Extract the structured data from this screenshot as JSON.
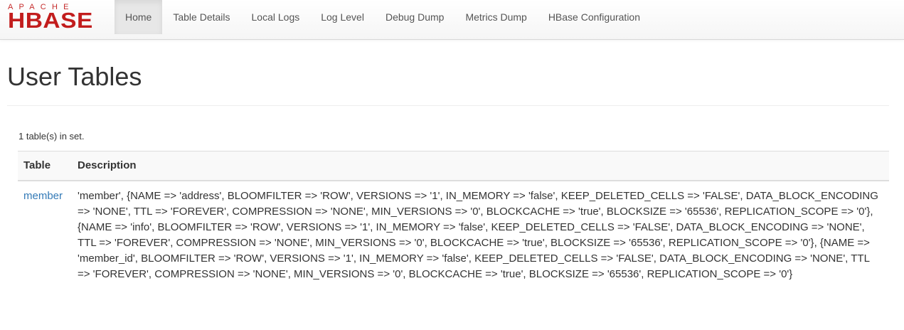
{
  "brand": {
    "top_text": "APACHE",
    "main_text": "HBASE",
    "color": "#c21d1d"
  },
  "nav": {
    "items": [
      {
        "label": "Home",
        "active": true
      },
      {
        "label": "Table Details"
      },
      {
        "label": "Local Logs"
      },
      {
        "label": "Log Level"
      },
      {
        "label": "Debug Dump"
      },
      {
        "label": "Metrics Dump"
      },
      {
        "label": "HBase Configuration"
      }
    ]
  },
  "page": {
    "title": "User Tables",
    "summary": "1 table(s) in set."
  },
  "table": {
    "headers": {
      "table": "Table",
      "description": "Description"
    },
    "rows": [
      {
        "name": "member",
        "description": "'member', {NAME => 'address', BLOOMFILTER => 'ROW', VERSIONS => '1', IN_MEMORY => 'false', KEEP_DELETED_CELLS => 'FALSE', DATA_BLOCK_ENCODING => 'NONE', TTL => 'FOREVER', COMPRESSION => 'NONE', MIN_VERSIONS => '0', BLOCKCACHE => 'true', BLOCKSIZE => '65536', REPLICATION_SCOPE => '0'}, {NAME => 'info', BLOOMFILTER => 'ROW', VERSIONS => '1', IN_MEMORY => 'false', KEEP_DELETED_CELLS => 'FALSE', DATA_BLOCK_ENCODING => 'NONE', TTL => 'FOREVER', COMPRESSION => 'NONE', MIN_VERSIONS => '0', BLOCKCACHE => 'true', BLOCKSIZE => '65536', REPLICATION_SCOPE => '0'}, {NAME => 'member_id', BLOOMFILTER => 'ROW', VERSIONS => '1', IN_MEMORY => 'false', KEEP_DELETED_CELLS => 'FALSE', DATA_BLOCK_ENCODING => 'NONE', TTL => 'FOREVER', COMPRESSION => 'NONE', MIN_VERSIONS => '0', BLOCKCACHE => 'true', BLOCKSIZE => '65536', REPLICATION_SCOPE => '0'}"
      }
    ]
  },
  "colors": {
    "link": "#337ab7",
    "text": "#333333",
    "nav_active_bg": "#e7e7e7"
  }
}
